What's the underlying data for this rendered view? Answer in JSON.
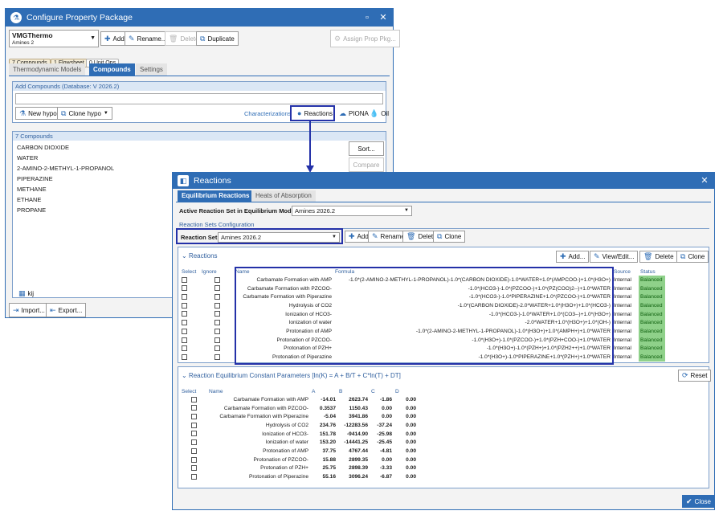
{
  "back_window": {
    "title": "Configure Property Package",
    "package_name": "VMGThermo",
    "package_sub": "Amines 2",
    "toolbar": {
      "add": "Add",
      "rename": "Rename...",
      "delete": "Delete",
      "duplicate": "Duplicate",
      "assign": "Assign Prop Pkg..."
    },
    "badges": [
      "7 Compounds",
      "1 Flowsheet",
      "0 Unit Ops"
    ],
    "tabs": [
      "Thermodynamic Models",
      "Compounds",
      "Settings"
    ],
    "add_compounds_label": "Add Compounds  (Database: V 2026.2)",
    "buttons": {
      "new_hypo": "New hypo",
      "clone_hypo": "Clone hypo",
      "characterizations": "Characterizations",
      "reactions": "Reactions",
      "piona": "PIONA",
      "oil": "Oil"
    },
    "compound_count_label": "7 Compounds",
    "compounds": [
      "CARBON DIOXIDE",
      "WATER",
      "2-AMINO-2-METHYL-1-PROPANOL",
      "PIPERAZINE",
      "METHANE",
      "ETHANE",
      "PROPANE"
    ],
    "sort": "Sort...",
    "compare": "Compare",
    "kij": "kij",
    "import": "Import...",
    "export": "Export..."
  },
  "reactions_window": {
    "title": "Reactions",
    "tabs": [
      "Equilibrium Reactions",
      "Heats of Absorption"
    ],
    "active_set_label": "Active Reaction Set in Equilibrium Model:",
    "active_set_value": "Amines 2026.2",
    "config_label": "Reaction Sets Configuration",
    "reaction_set_label": "Reaction Set",
    "reaction_set_value": "Amines 2026.2",
    "set_buttons": {
      "add": "Add",
      "rename": "Rename",
      "delete": "Delete",
      "clone": "Clone"
    },
    "reactions_section": "Reactions",
    "reaction_buttons": {
      "add": "Add...",
      "view_edit": "View/Edit...",
      "delete": "Delete",
      "clone": "Clone"
    },
    "columns": [
      "Select",
      "Ignore",
      "Name",
      "Formula",
      "Source",
      "Status"
    ],
    "reactions": [
      {
        "name": "Carbamate Formation with AMP",
        "formula": "-1.0*(2-AMINO-2-METHYL-1-PROPANOL)-1.0*(CARBON DIOXIDE)-1.0*WATER+1.0*(AMPCOO-)+1.0*(H3O+)",
        "source": "Internal",
        "status": "Balanced"
      },
      {
        "name": "Carbamate Formation with PZCOO-",
        "formula": "-1.0*(HCO3-)-1.0*(PZCOO-)+1.0*(PZ(COO)2--)+1.0*WATER",
        "source": "Internal",
        "status": "Balanced"
      },
      {
        "name": "Carbamate Formation with Piperazine",
        "formula": "-1.0*(HCO3-)-1.0*PIPERAZINE+1.0*(PZCOO-)+1.0*WATER",
        "source": "Internal",
        "status": "Balanced"
      },
      {
        "name": "Hydrolysis of CO2",
        "formula": "-1.0*(CARBON DIOXIDE)-2.0*WATER+1.0*(H3O+)+1.0*(HCO3-)",
        "source": "Internal",
        "status": "Balanced"
      },
      {
        "name": "Ionization of HCO3-",
        "formula": "-1.0*(HCO3-)-1.0*WATER+1.0*(CO3--)+1.0*(H3O+)",
        "source": "Internal",
        "status": "Balanced"
      },
      {
        "name": "Ionization of water",
        "formula": "-2.0*WATER+1.0*(H3O+)+1.0*(OH-)",
        "source": "Internal",
        "status": "Balanced"
      },
      {
        "name": "Protonation of AMP",
        "formula": "-1.0*(2-AMINO-2-METHYL-1-PROPANOL)-1.0*(H3O+)+1.0*(AMPH+)+1.0*WATER",
        "source": "Internal",
        "status": "Balanced"
      },
      {
        "name": "Protonation of PZCOO-",
        "formula": "-1.0*(H3O+)-1.0*(PZCOO-)+1.0*(PZH+COO-)+1.0*WATER",
        "source": "Internal",
        "status": "Balanced"
      },
      {
        "name": "Protonation of PZH+",
        "formula": "-1.0*(H3O+)-1.0*(PZH+)+1.0*(PZH2++)+1.0*WATER",
        "source": "Internal",
        "status": "Balanced"
      },
      {
        "name": "Protonation of Piperazine",
        "formula": "-1.0*(H3O+)-1.0*PIPERAZINE+1.0*(PZH+)+1.0*WATER",
        "source": "Internal",
        "status": "Balanced"
      }
    ],
    "keq_section": "Reaction Equilibrium Constant Parameters [ln(K) = A + B/T + C*ln(T) + DT]",
    "reset": "Reset",
    "keq_columns": [
      "Select",
      "Name",
      "A",
      "B",
      "C",
      "D"
    ],
    "keq": [
      {
        "name": "Carbamate Formation with AMP",
        "a": "-14.01",
        "b": "2623.74",
        "c": "-1.86",
        "d": "0.00"
      },
      {
        "name": "Carbamate Formation with PZCOO-",
        "a": "0.3537",
        "b": "1150.43",
        "c": "0.00",
        "d": "0.00"
      },
      {
        "name": "Carbamate Formation with Piperazine",
        "a": "-5.04",
        "b": "3941.86",
        "c": "0.00",
        "d": "0.00"
      },
      {
        "name": "Hydrolysis of CO2",
        "a": "234.76",
        "b": "-12283.56",
        "c": "-37.24",
        "d": "0.00"
      },
      {
        "name": "Ionization of HCO3-",
        "a": "151.78",
        "b": "-9414.90",
        "c": "-25.98",
        "d": "0.00"
      },
      {
        "name": "Ionization of water",
        "a": "153.20",
        "b": "-14441.25",
        "c": "-25.45",
        "d": "0.00"
      },
      {
        "name": "Protonation of AMP",
        "a": "37.75",
        "b": "4767.44",
        "c": "-4.81",
        "d": "0.00"
      },
      {
        "name": "Protonation of PZCOO-",
        "a": "15.88",
        "b": "2899.35",
        "c": "0.00",
        "d": "0.00"
      },
      {
        "name": "Protonation of PZH+",
        "a": "25.75",
        "b": "2898.39",
        "c": "-3.33",
        "d": "0.00"
      },
      {
        "name": "Protonation of Piperazine",
        "a": "55.16",
        "b": "3096.24",
        "c": "-6.87",
        "d": "0.00"
      }
    ],
    "close": "Close"
  },
  "colors": {
    "accent": "#2f6db5",
    "highlight": "#2431a8",
    "balanced": "#8fd18a"
  }
}
